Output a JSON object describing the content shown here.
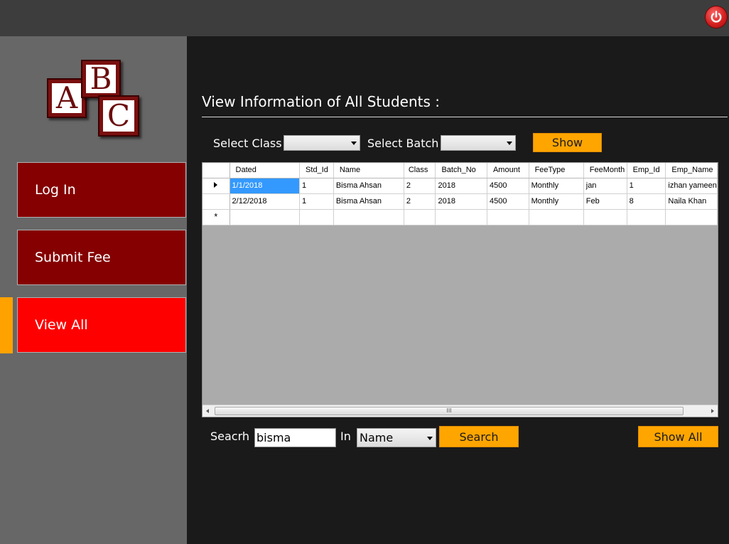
{
  "topbar": {
    "power_icon": "power-icon",
    "power_color": "#d42020"
  },
  "logo": {
    "letters": [
      "A",
      "B",
      "C"
    ]
  },
  "sidebar": {
    "items": [
      {
        "label": "Log In",
        "active": false
      },
      {
        "label": "Submit Fee",
        "active": false
      },
      {
        "label": "View All",
        "active": true
      }
    ],
    "colors": {
      "item": "#850000",
      "active": "#fe0000",
      "indicator": "#ffa200"
    }
  },
  "main": {
    "title": "View Information of All Students :",
    "filters": {
      "class_label": "Select Class",
      "class_value": "",
      "batch_label": "Select Batch",
      "batch_value": "",
      "show_label": "Show"
    },
    "grid": {
      "columns": [
        "Dated",
        "Std_Id",
        "Name",
        "Class",
        "Batch_No",
        "Amount",
        "FeeType",
        "FeeMonth",
        "Emp_Id",
        "Emp_Name"
      ],
      "rows": [
        [
          "1/1/2018",
          "1",
          "Bisma Ahsan",
          "2",
          "2018",
          "4500",
          "Monthly",
          "jan",
          "1",
          "izhan yameen"
        ],
        [
          "2/12/2018",
          "1",
          "Bisma Ahsan",
          "2",
          "2018",
          "4500",
          "Monthly",
          "Feb",
          "8",
          "Naila Khan"
        ]
      ],
      "new_row_marker": "*",
      "scroll_grip": "III"
    },
    "search": {
      "label": "Seacrh",
      "value": "bisma",
      "in_label": "In",
      "field_value": "Name",
      "search_label": "Search",
      "show_all_label": "Show All"
    },
    "accent": "#ffa500"
  }
}
